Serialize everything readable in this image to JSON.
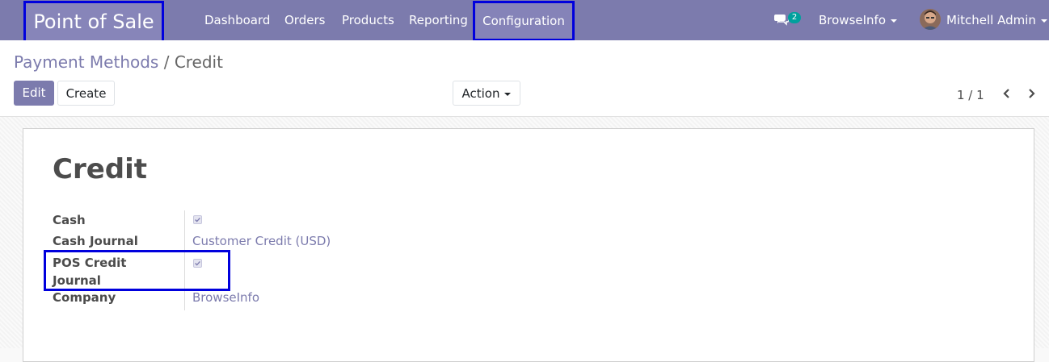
{
  "navbar": {
    "brand": "Point of Sale",
    "menu": [
      "Dashboard",
      "Orders",
      "Products",
      "Reporting"
    ],
    "active_menu": "Configuration",
    "message_count": "2",
    "company": "BrowseInfo",
    "user": "Mitchell Admin"
  },
  "breadcrumb": {
    "parent": "Payment Methods",
    "separator": " / ",
    "current": "Credit"
  },
  "toolbar": {
    "edit": "Edit",
    "create": "Create",
    "action": "Action",
    "pager": "1 / 1"
  },
  "record": {
    "title": "Credit",
    "fields": [
      {
        "label": "Cash",
        "type": "checkbox",
        "checked": true
      },
      {
        "label": "Cash Journal",
        "value": "Customer Credit (USD)"
      },
      {
        "label": "POS Credit Journal",
        "type": "checkbox",
        "checked": true
      },
      {
        "label": "Company",
        "value": "BrowseInfo"
      }
    ]
  },
  "colors": {
    "primary": "#7c7bad",
    "highlight": "#0000dd",
    "badge": "#00a09d"
  }
}
